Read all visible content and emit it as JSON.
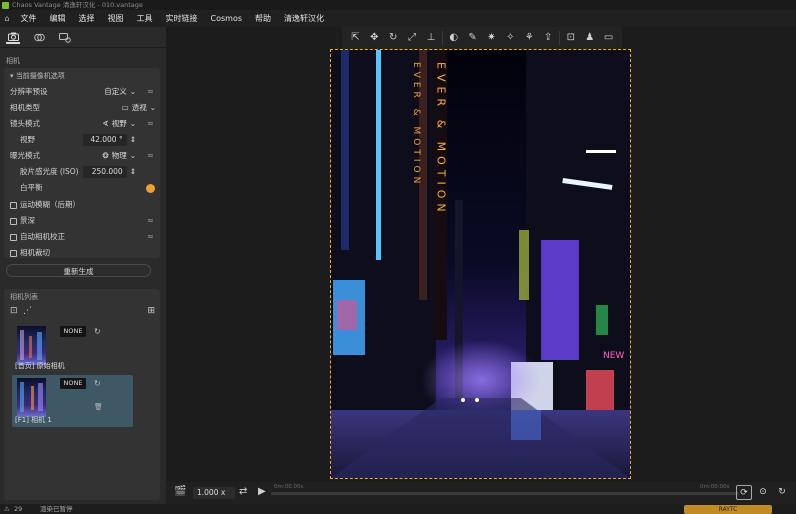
{
  "app_title": "Chaos Vantage 清逸轩汉化 - 010.vantage",
  "menu": [
    "文件",
    "编辑",
    "选择",
    "视图",
    "工具",
    "实时链接",
    "Cosmos",
    "帮助",
    "清逸轩汉化"
  ],
  "left": {
    "section_camera": "相机",
    "group_title": "当前摄像机选项",
    "rows": [
      {
        "label": "分辨率预设",
        "value": "自定义"
      },
      {
        "label": "相机类型",
        "value": "透视"
      },
      {
        "label": "镜头模式",
        "value": "视野"
      },
      {
        "label": "视野",
        "value": "42.000 °"
      },
      {
        "label": "曝光模式",
        "value": "物理"
      },
      {
        "label": "胶片感光度 (ISO)",
        "value": "250.000"
      },
      {
        "label": "白平衡",
        "value": ""
      }
    ],
    "checks": [
      "运动模糊（后期）",
      "景深",
      "自动相机校正",
      "相机裁切"
    ],
    "regen": "重新生成",
    "camlist_title": "相机列表",
    "cameras": [
      {
        "name": "[首页] 原始相机",
        "none": "NONE"
      },
      {
        "name": "[F1] 相机 1",
        "none": "NONE"
      }
    ]
  },
  "bottom": {
    "zoom": "1.000 x",
    "time_start": "0m:00.00s",
    "time_end": "0m:00.00s"
  },
  "status": {
    "count": "29",
    "text": "渲染已暂停",
    "render_label": "RAYTC"
  },
  "scene": {
    "sign_left": "EVER & MOTION",
    "sign_right": "EVER & MOTION",
    "neon_text": "NEW"
  },
  "colors": {
    "accent": "#e8b030",
    "orb": "#f0a030",
    "selected_camera": "#3e5866"
  }
}
